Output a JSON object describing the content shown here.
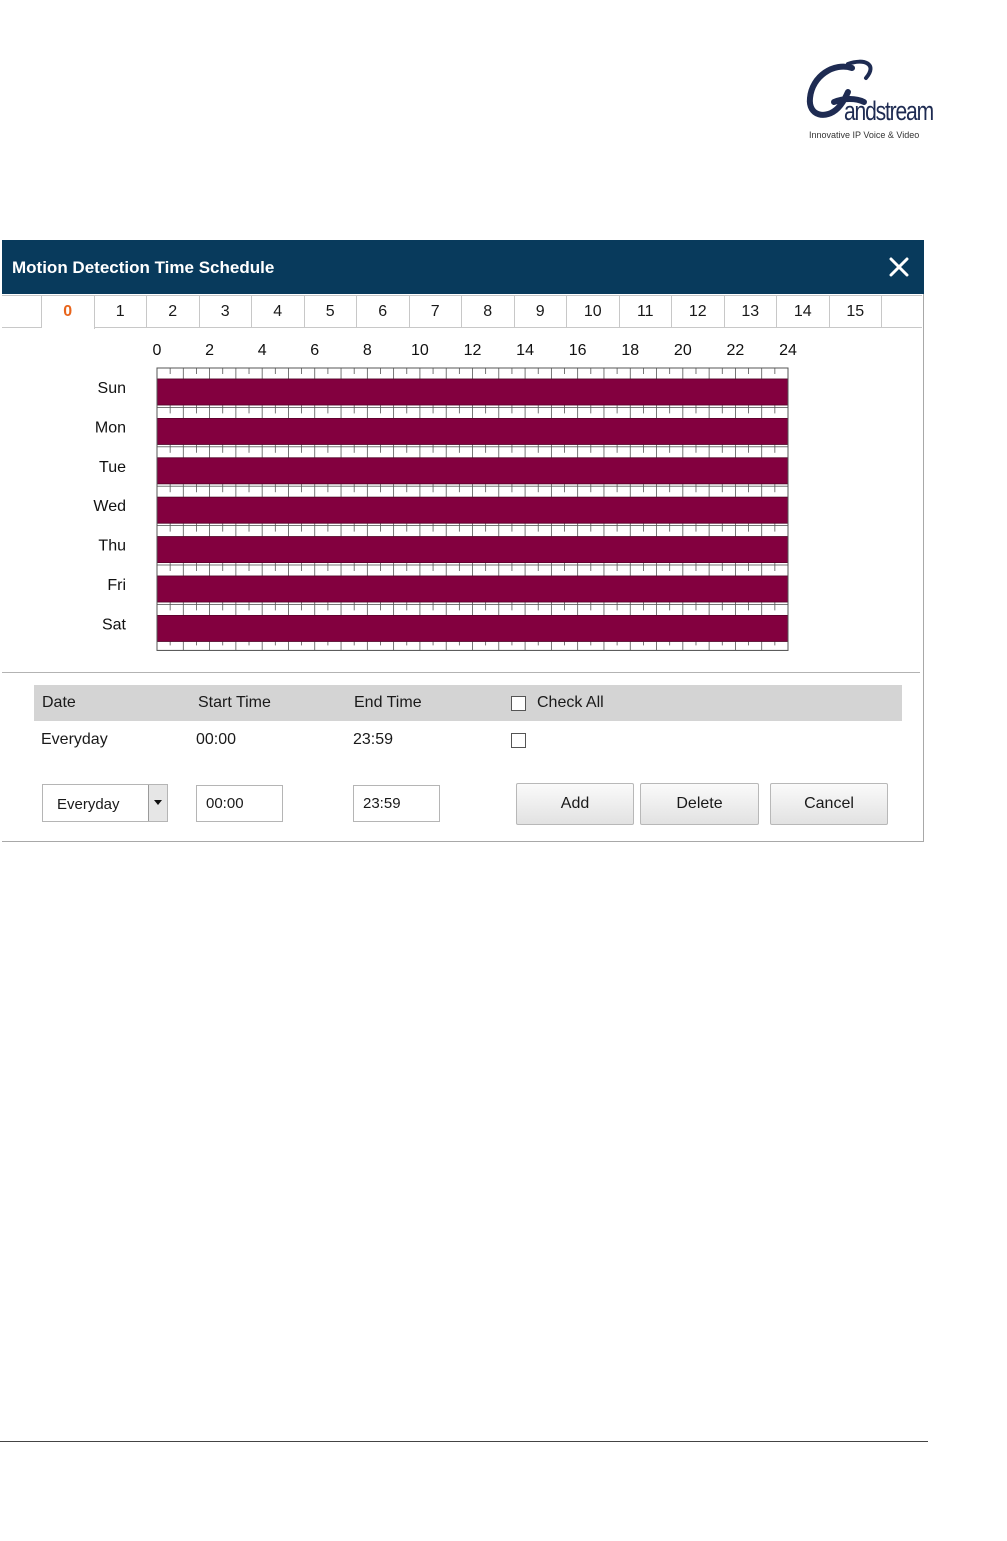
{
  "brand": {
    "name": "andstream",
    "tagline": "Innovative IP Voice & Video"
  },
  "dialog": {
    "title": "Motion Detection Time Schedule"
  },
  "tabs": [
    "0",
    "1",
    "2",
    "3",
    "4",
    "5",
    "6",
    "7",
    "8",
    "9",
    "10",
    "11",
    "12",
    "13",
    "14",
    "15"
  ],
  "active_tab": "0",
  "schedule_chart": {
    "type": "bar",
    "hour_ticks": [
      "0",
      "2",
      "4",
      "6",
      "8",
      "10",
      "12",
      "14",
      "16",
      "18",
      "20",
      "22",
      "24"
    ],
    "days": [
      "Sun",
      "Mon",
      "Tue",
      "Wed",
      "Thu",
      "Fri",
      "Sat"
    ],
    "x_range": [
      0,
      24
    ],
    "active_periods": [
      {
        "day": "Sun",
        "start": 0,
        "end": 24
      },
      {
        "day": "Mon",
        "start": 0,
        "end": 24
      },
      {
        "day": "Tue",
        "start": 0,
        "end": 24
      },
      {
        "day": "Wed",
        "start": 0,
        "end": 24
      },
      {
        "day": "Thu",
        "start": 0,
        "end": 24
      },
      {
        "day": "Fri",
        "start": 0,
        "end": 24
      },
      {
        "day": "Sat",
        "start": 0,
        "end": 24
      }
    ],
    "bar_color": "#83003f"
  },
  "table": {
    "headers": {
      "date": "Date",
      "start": "Start Time",
      "end": "End Time",
      "check_all": "Check All"
    },
    "rows": [
      {
        "date": "Everyday",
        "start": "00:00",
        "end": "23:59"
      }
    ]
  },
  "form": {
    "date_select": "Everyday",
    "start_value": "00:00",
    "end_value": "23:59",
    "add_label": "Add",
    "delete_label": "Delete",
    "cancel_label": "Cancel"
  },
  "colors": {
    "title_bar": "#083a5c",
    "active_tab": "#e8641b"
  }
}
